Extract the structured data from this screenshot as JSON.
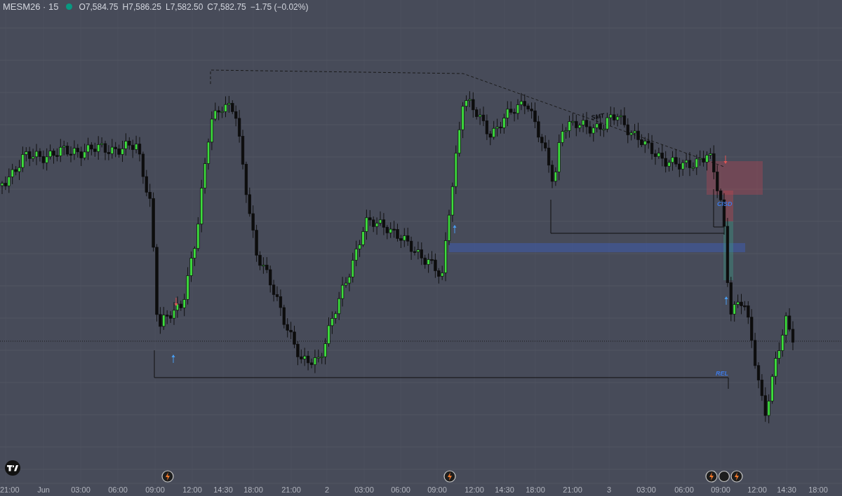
{
  "legend": {
    "symbol": "MESM26 · 15",
    "ohlc": [
      {
        "label": "O",
        "value": "7,584.75"
      },
      {
        "label": "H",
        "value": "7,586.25"
      },
      {
        "label": "L",
        "value": "7,582.50"
      },
      {
        "label": "C",
        "value": "7,582.75"
      }
    ],
    "change": "−1.75 (−0.02%)"
  },
  "annotations": [
    {
      "kind": "smt",
      "text": "SMT"
    },
    {
      "kind": "cisd",
      "text": "CISD"
    },
    {
      "kind": "rel",
      "text": "REL"
    }
  ],
  "time_axis": [
    "21:00",
    "Jun",
    "03:00",
    "06:00",
    "09:00",
    "12:00",
    "14:30",
    "18:00",
    "21:00",
    "2",
    "03:00",
    "06:00",
    "09:00",
    "12:00",
    "14:30",
    "18:00",
    "21:00",
    "3",
    "03:00",
    "06:00",
    "09:00",
    "12:00",
    "14:30",
    "18:00"
  ]
}
